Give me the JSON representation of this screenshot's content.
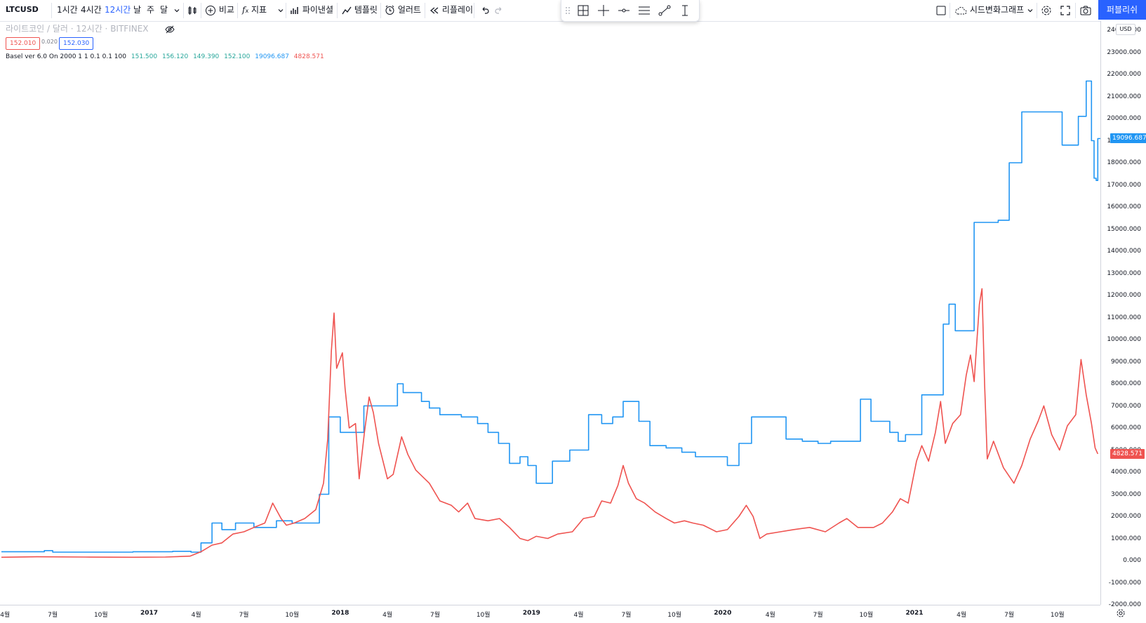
{
  "toolbar": {
    "symbol": "LTCUSD",
    "intervals": [
      "1시간",
      "4시간",
      "12시간",
      "날",
      "주",
      "달"
    ],
    "active_interval": "12시간",
    "compare_label": "비교",
    "indicators_label": "지표",
    "pine_label": "파이낸셜",
    "template_label": "템플릿",
    "alert_label": "얼러트",
    "replay_label": "리플레이",
    "layout_label": "시드변화그래프",
    "publish_label": "퍼블리쉬"
  },
  "legend": {
    "title": "라이트코인 / 달러 · 12시간 · BITFINEX",
    "bid": "152.010",
    "spread": "0.020",
    "ask": "152.030",
    "indicator_name": "Basel ver 6.0 On 2000 1 1 0.1 0.1 100",
    "values": [
      {
        "text": "151.500",
        "color": "#26a69a"
      },
      {
        "text": "156.120",
        "color": "#26a69a"
      },
      {
        "text": "149.390",
        "color": "#26a69a"
      },
      {
        "text": "152.100",
        "color": "#26a69a"
      },
      {
        "text": "19096.687",
        "color": "#2196f3"
      },
      {
        "text": "4828.571",
        "color": "#ef5350"
      }
    ]
  },
  "price_axis": {
    "currency": "USD",
    "ticks": [
      "24000.000",
      "23000.000",
      "22000.000",
      "21000.000",
      "20000.000",
      "19000.000",
      "18000.000",
      "17000.000",
      "16000.000",
      "15000.000",
      "14000.000",
      "13000.000",
      "12000.000",
      "11000.000",
      "10000.000",
      "9000.000",
      "8000.000",
      "7000.000",
      "6000.000",
      "5000.000",
      "4000.000",
      "3000.000",
      "2000.000",
      "1000.000",
      "0.000",
      "-1000.000",
      "-2000.000"
    ],
    "blue_label": "19096.687",
    "red_label": "4828.571"
  },
  "time_axis": {
    "ticks": [
      {
        "label": "4월"
      },
      {
        "label": "7월"
      },
      {
        "label": "10월"
      },
      {
        "label": "2017",
        "year": true
      },
      {
        "label": "4월"
      },
      {
        "label": "7월"
      },
      {
        "label": "10월"
      },
      {
        "label": "2018",
        "year": true
      },
      {
        "label": "4월"
      },
      {
        "label": "7월"
      },
      {
        "label": "10월"
      },
      {
        "label": "2019",
        "year": true
      },
      {
        "label": "4월"
      },
      {
        "label": "7월"
      },
      {
        "label": "10월"
      },
      {
        "label": "2020",
        "year": true
      },
      {
        "label": "4월"
      },
      {
        "label": "7월"
      },
      {
        "label": "10월"
      },
      {
        "label": "2021",
        "year": true
      },
      {
        "label": "4월"
      },
      {
        "label": "7월"
      },
      {
        "label": "10월"
      }
    ]
  },
  "chart_data": {
    "type": "line",
    "xlabel": "",
    "ylabel": "",
    "ylim": [
      -2000,
      24000
    ],
    "xlim": [
      "2016-03-25",
      "2021-12-18"
    ],
    "grid": false,
    "series": [
      {
        "color": "#2196f3",
        "step": true,
        "points": [
          [
            "2016-03-25",
            400
          ],
          [
            "2016-06-15",
            450
          ],
          [
            "2016-07-01",
            380
          ],
          [
            "2016-12-01",
            400
          ],
          [
            "2017-02-15",
            420
          ],
          [
            "2017-03-22",
            380
          ],
          [
            "2017-04-10",
            800
          ],
          [
            "2017-05-01",
            1700
          ],
          [
            "2017-05-20",
            1400
          ],
          [
            "2017-06-15",
            1700
          ],
          [
            "2017-07-20",
            1500
          ],
          [
            "2017-09-01",
            1800
          ],
          [
            "2017-10-01",
            1700
          ],
          [
            "2017-11-22",
            3000
          ],
          [
            "2017-12-10",
            6500
          ],
          [
            "2018-01-01",
            5800
          ],
          [
            "2018-02-15",
            7000
          ],
          [
            "2018-04-20",
            8000
          ],
          [
            "2018-05-01",
            7600
          ],
          [
            "2018-06-05",
            7200
          ],
          [
            "2018-06-20",
            6900
          ],
          [
            "2018-07-10",
            6600
          ],
          [
            "2018-08-20",
            6500
          ],
          [
            "2018-09-20",
            6200
          ],
          [
            "2018-10-10",
            5800
          ],
          [
            "2018-10-30",
            5300
          ],
          [
            "2018-11-20",
            4400
          ],
          [
            "2018-12-10",
            4700
          ],
          [
            "2018-12-25",
            4300
          ],
          [
            "2019-01-10",
            3500
          ],
          [
            "2019-02-10",
            4500
          ],
          [
            "2019-03-15",
            5000
          ],
          [
            "2019-04-20",
            6600
          ],
          [
            "2019-05-15",
            6200
          ],
          [
            "2019-06-05",
            6500
          ],
          [
            "2019-06-25",
            7200
          ],
          [
            "2019-07-25",
            6300
          ],
          [
            "2019-08-15",
            5200
          ],
          [
            "2019-09-15",
            5100
          ],
          [
            "2019-10-15",
            4900
          ],
          [
            "2019-11-10",
            4700
          ],
          [
            "2020-01-10",
            4300
          ],
          [
            "2020-02-01",
            5300
          ],
          [
            "2020-02-25",
            6500
          ],
          [
            "2020-05-01",
            5500
          ],
          [
            "2020-06-01",
            5400
          ],
          [
            "2020-07-01",
            5300
          ],
          [
            "2020-07-25",
            5400
          ],
          [
            "2020-09-20",
            7300
          ],
          [
            "2020-10-10",
            6300
          ],
          [
            "2020-11-15",
            5800
          ],
          [
            "2020-12-01",
            5400
          ],
          [
            "2020-12-15",
            5700
          ],
          [
            "2021-01-15",
            7500
          ],
          [
            "2021-02-25",
            10700
          ],
          [
            "2021-03-08",
            11600
          ],
          [
            "2021-03-20",
            10400
          ],
          [
            "2021-04-25",
            15300
          ],
          [
            "2021-06-10",
            15400
          ],
          [
            "2021-07-01",
            18000
          ],
          [
            "2021-07-25",
            20300
          ],
          [
            "2021-10-10",
            18800
          ],
          [
            "2021-11-10",
            20100
          ],
          [
            "2021-11-25",
            21700
          ],
          [
            "2021-12-05",
            19000
          ],
          [
            "2021-12-10",
            17300
          ],
          [
            "2021-12-14",
            17200
          ],
          [
            "2021-12-17",
            19096.687
          ]
        ]
      },
      {
        "color": "#ef5350",
        "step": false,
        "points": [
          [
            "2016-03-25",
            150
          ],
          [
            "2016-06-01",
            170
          ],
          [
            "2016-09-01",
            160
          ],
          [
            "2016-12-01",
            150
          ],
          [
            "2017-02-01",
            160
          ],
          [
            "2017-03-20",
            200
          ],
          [
            "2017-04-10",
            400
          ],
          [
            "2017-05-01",
            700
          ],
          [
            "2017-05-20",
            800
          ],
          [
            "2017-06-10",
            1200
          ],
          [
            "2017-07-01",
            1300
          ],
          [
            "2017-07-20",
            1500
          ],
          [
            "2017-08-10",
            1700
          ],
          [
            "2017-08-25",
            2600
          ],
          [
            "2017-09-10",
            1900
          ],
          [
            "2017-09-20",
            1600
          ],
          [
            "2017-10-05",
            1700
          ],
          [
            "2017-10-25",
            1900
          ],
          [
            "2017-11-15",
            2300
          ],
          [
            "2017-11-30",
            3500
          ],
          [
            "2017-12-08",
            5500
          ],
          [
            "2017-12-15",
            9500
          ],
          [
            "2017-12-20",
            11200
          ],
          [
            "2017-12-25",
            8700
          ],
          [
            "2018-01-05",
            9400
          ],
          [
            "2018-01-10",
            7800
          ],
          [
            "2018-01-18",
            6000
          ],
          [
            "2018-01-30",
            6200
          ],
          [
            "2018-02-06",
            3700
          ],
          [
            "2018-02-16",
            5800
          ],
          [
            "2018-02-25",
            7400
          ],
          [
            "2018-03-05",
            6700
          ],
          [
            "2018-03-15",
            5300
          ],
          [
            "2018-04-01",
            3700
          ],
          [
            "2018-04-12",
            3900
          ],
          [
            "2018-04-28",
            5600
          ],
          [
            "2018-05-10",
            4800
          ],
          [
            "2018-05-25",
            4100
          ],
          [
            "2018-06-20",
            3500
          ],
          [
            "2018-07-10",
            2700
          ],
          [
            "2018-08-01",
            2500
          ],
          [
            "2018-08-15",
            2200
          ],
          [
            "2018-09-01",
            2600
          ],
          [
            "2018-09-15",
            1900
          ],
          [
            "2018-10-10",
            1800
          ],
          [
            "2018-11-01",
            1900
          ],
          [
            "2018-11-20",
            1500
          ],
          [
            "2018-12-10",
            1000
          ],
          [
            "2018-12-25",
            900
          ],
          [
            "2019-01-10",
            1100
          ],
          [
            "2019-02-01",
            1000
          ],
          [
            "2019-02-20",
            1200
          ],
          [
            "2019-03-20",
            1300
          ],
          [
            "2019-04-10",
            1900
          ],
          [
            "2019-05-01",
            2000
          ],
          [
            "2019-05-15",
            2700
          ],
          [
            "2019-06-01",
            2600
          ],
          [
            "2019-06-15",
            3400
          ],
          [
            "2019-06-25",
            4300
          ],
          [
            "2019-07-05",
            3500
          ],
          [
            "2019-07-20",
            2800
          ],
          [
            "2019-08-05",
            2600
          ],
          [
            "2019-08-25",
            2200
          ],
          [
            "2019-09-15",
            1900
          ],
          [
            "2019-10-01",
            1700
          ],
          [
            "2019-10-20",
            1800
          ],
          [
            "2019-11-05",
            1700
          ],
          [
            "2019-11-25",
            1600
          ],
          [
            "2019-12-20",
            1300
          ],
          [
            "2020-01-10",
            1400
          ],
          [
            "2020-02-01",
            2000
          ],
          [
            "2020-02-15",
            2500
          ],
          [
            "2020-02-28",
            2000
          ],
          [
            "2020-03-12",
            1000
          ],
          [
            "2020-03-25",
            1200
          ],
          [
            "2020-04-20",
            1300
          ],
          [
            "2020-05-15",
            1400
          ],
          [
            "2020-06-15",
            1500
          ],
          [
            "2020-07-15",
            1300
          ],
          [
            "2020-08-10",
            1700
          ],
          [
            "2020-08-25",
            1900
          ],
          [
            "2020-09-15",
            1500
          ],
          [
            "2020-10-15",
            1500
          ],
          [
            "2020-11-01",
            1700
          ],
          [
            "2020-11-20",
            2200
          ],
          [
            "2020-12-05",
            2800
          ],
          [
            "2020-12-20",
            2600
          ],
          [
            "2021-01-05",
            4500
          ],
          [
            "2021-01-15",
            5200
          ],
          [
            "2021-01-28",
            4500
          ],
          [
            "2021-02-10",
            5800
          ],
          [
            "2021-02-20",
            7200
          ],
          [
            "2021-03-01",
            5300
          ],
          [
            "2021-03-15",
            6200
          ],
          [
            "2021-03-30",
            6600
          ],
          [
            "2021-04-10",
            8400
          ],
          [
            "2021-04-18",
            9300
          ],
          [
            "2021-04-25",
            8100
          ],
          [
            "2021-05-05",
            11600
          ],
          [
            "2021-05-10",
            12300
          ],
          [
            "2021-05-15",
            8000
          ],
          [
            "2021-05-20",
            4600
          ],
          [
            "2021-06-01",
            5400
          ],
          [
            "2021-06-20",
            4200
          ],
          [
            "2021-07-10",
            3500
          ],
          [
            "2021-07-25",
            4300
          ],
          [
            "2021-08-10",
            5500
          ],
          [
            "2021-08-25",
            6300
          ],
          [
            "2021-09-05",
            7000
          ],
          [
            "2021-09-20",
            5700
          ],
          [
            "2021-10-05",
            5000
          ],
          [
            "2021-10-20",
            6100
          ],
          [
            "2021-11-05",
            6600
          ],
          [
            "2021-11-15",
            9100
          ],
          [
            "2021-11-25",
            7500
          ],
          [
            "2021-12-05",
            6200
          ],
          [
            "2021-12-12",
            5100
          ],
          [
            "2021-12-17",
            4828.571
          ]
        ]
      }
    ]
  }
}
